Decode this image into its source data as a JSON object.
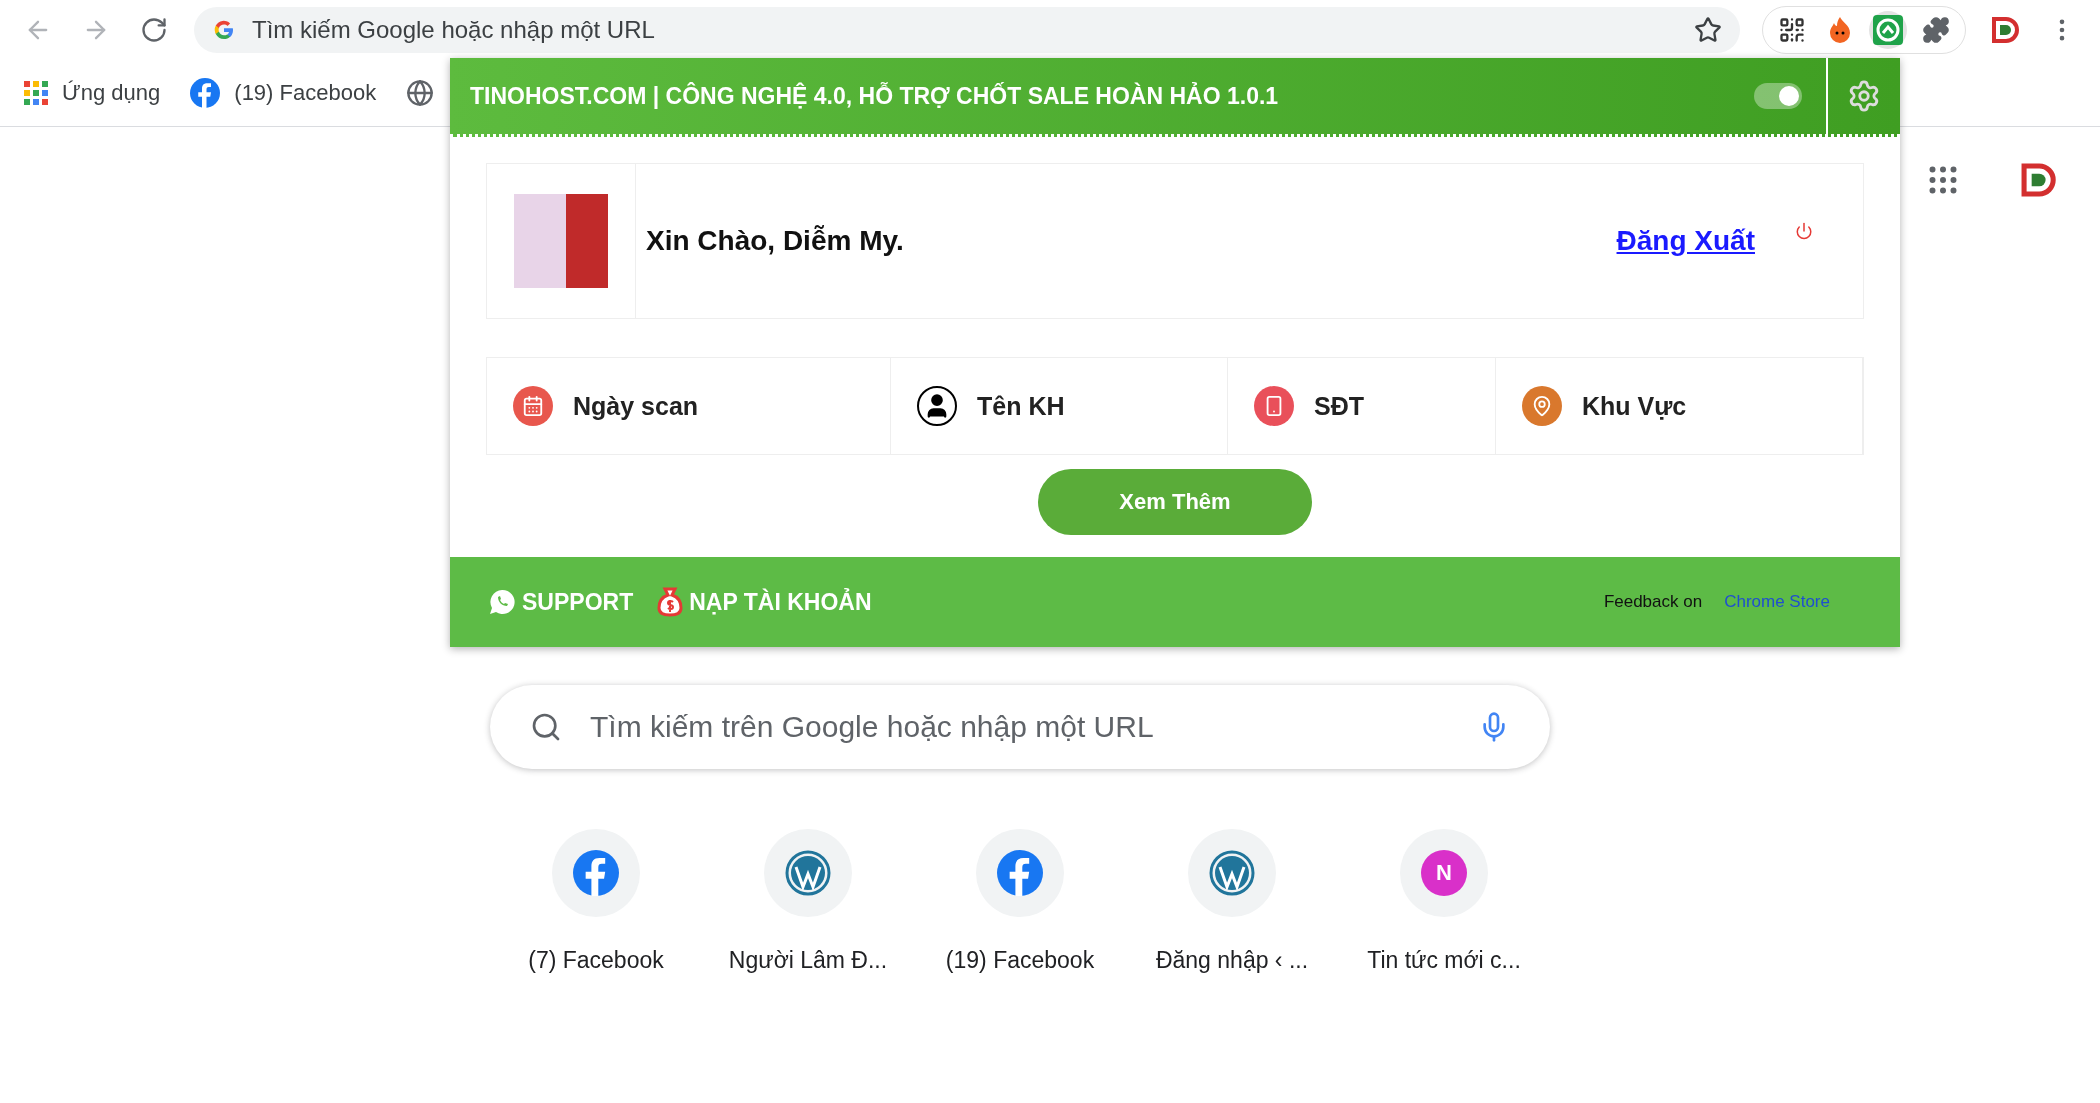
{
  "omnibox": {
    "placeholder": "Tìm kiếm Google hoặc nhập một URL"
  },
  "bookmarks": [
    {
      "kind": "apps",
      "label": "Ứng dụng"
    },
    {
      "kind": "facebook",
      "label": "(19) Facebook"
    },
    {
      "kind": "globe"
    }
  ],
  "popup": {
    "title": "TINOHOST.COM | CÔNG NGHỆ 4.0, HỖ TRỢ CHỐT SALE HOÀN HẢO 1.0.1",
    "enabled": true,
    "greeting": "Xin Chào, Diễm My.",
    "logout": "Đăng Xuất",
    "fields": [
      {
        "kind": "calendar",
        "label": "Ngày scan"
      },
      {
        "kind": "person",
        "label": "Tên KH"
      },
      {
        "kind": "phone",
        "label": "SĐT"
      },
      {
        "kind": "pin",
        "label": "Khu Vực"
      }
    ],
    "more_button": "Xem Thêm",
    "footer": {
      "support": "SUPPORT",
      "topup": "NẠP TÀI KHOẢN",
      "feedback": "Feedback on",
      "store_link": "Chrome Store"
    }
  },
  "search": {
    "placeholder": "Tìm kiếm trên Google hoặc nhập một URL"
  },
  "shortcuts": [
    {
      "kind": "facebook",
      "label": "(7) Facebook"
    },
    {
      "kind": "wordpress",
      "label": "Người Lâm Đ..."
    },
    {
      "kind": "facebook",
      "label": "(19) Facebook"
    },
    {
      "kind": "wordpress",
      "label": "Đăng nhập ‹ ..."
    },
    {
      "kind": "letter",
      "letter": "N",
      "color": "#d930c9",
      "label": "Tin tức mới c..."
    }
  ]
}
